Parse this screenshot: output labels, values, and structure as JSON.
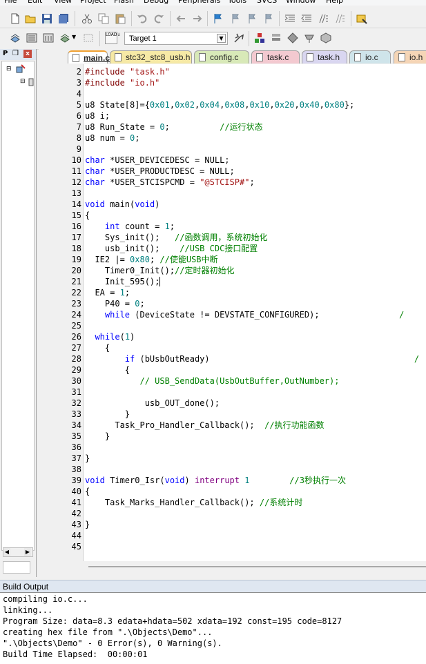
{
  "menu": [
    "File",
    "Edit",
    "View",
    "Project",
    "Flash",
    "Debug",
    "Peripherals",
    "Tools",
    "SVCS",
    "Window",
    "Help"
  ],
  "toolbar": {
    "target_label": "Target 1",
    "load_label": "LOAD"
  },
  "project_panel": {
    "title": "P",
    "pin": "❒",
    "close": "x"
  },
  "tabs": [
    {
      "label": "main.c",
      "active": true,
      "color": "#ffffff"
    },
    {
      "label": "stc32_stc8_usb.h",
      "active": false,
      "color": "#f6e9a5"
    },
    {
      "label": "config.c",
      "active": false,
      "color": "#d8e9b8"
    },
    {
      "label": "task.c",
      "active": false,
      "color": "#f3c9d0"
    },
    {
      "label": "task.h",
      "active": false,
      "color": "#d9d6f0"
    },
    {
      "label": "io.c",
      "active": false,
      "color": "#cfe4ea"
    },
    {
      "label": "io.h",
      "active": false,
      "color": "#f5d5b6"
    }
  ],
  "code": [
    {
      "n": "2",
      "html": "<span class=\"pp\">#include</span> <span class=\"str\">\"task.h\"</span>"
    },
    {
      "n": "3",
      "html": "<span class=\"pp\">#include</span> <span class=\"str\">\"io.h\"</span>"
    },
    {
      "n": "4",
      "html": ""
    },
    {
      "n": "5",
      "html": "u8 State[8]={<span class=\"num\">0x01</span>,<span class=\"num\">0x02</span>,<span class=\"num\">0x04</span>,<span class=\"num\">0x08</span>,<span class=\"num\">0x10</span>,<span class=\"num\">0x20</span>,<span class=\"num\">0x40</span>,<span class=\"num\">0x80</span>};"
    },
    {
      "n": "6",
      "html": "u8 i;"
    },
    {
      "n": "7",
      "html": "u8 Run_State = <span class=\"num\">0</span>;          <span class=\"cmt\">//运行状态</span>"
    },
    {
      "n": "8",
      "html": "u8 num = <span class=\"num\">0</span>;"
    },
    {
      "n": "9",
      "html": ""
    },
    {
      "n": "10",
      "html": "<span class=\"kw\">char</span> *USER_DEVICEDESC = NULL;"
    },
    {
      "n": "11",
      "html": "<span class=\"kw\">char</span> *USER_PRODUCTDESC = NULL;"
    },
    {
      "n": "12",
      "html": "<span class=\"kw\">char</span> *USER_STCISPCMD = <span class=\"str\">\"@STCISP#\"</span>;"
    },
    {
      "n": "13",
      "html": ""
    },
    {
      "n": "14",
      "html": "<span class=\"kw\">void</span> main(<span class=\"kw\">void</span>)"
    },
    {
      "n": "15",
      "html": "{"
    },
    {
      "n": "16",
      "html": "    <span class=\"kw\">int</span> count = <span class=\"num\">1</span>;"
    },
    {
      "n": "17",
      "html": "    Sys_init();   <span class=\"cmt\">//函数调用，系统初始化</span>"
    },
    {
      "n": "18",
      "html": "    usb_init();    <span class=\"cmt\">//USB CDC接口配置</span>"
    },
    {
      "n": "19",
      "html": "  IE2 |= <span class=\"num\">0x80</span>; <span class=\"cmt\">//使能USB中断</span>"
    },
    {
      "n": "20",
      "html": "    Timer0_Init();<span class=\"cmt\">//定时器初始化</span>"
    },
    {
      "n": "21",
      "html": "    Init_595();<span class=\"caret\"></span>"
    },
    {
      "n": "22",
      "html": "  EA = <span class=\"num\">1</span>;"
    },
    {
      "n": "23",
      "html": "    P40 = <span class=\"num\">0</span>;"
    },
    {
      "n": "24",
      "html": "    <span class=\"kw\">while</span> (DeviceState != DEVSTATE_CONFIGURED);                <span class=\"cmt\">/</span>"
    },
    {
      "n": "25",
      "html": ""
    },
    {
      "n": "26",
      "html": "  <span class=\"kw\">while</span>(<span class=\"num\">1</span>)"
    },
    {
      "n": "27",
      "html": "    {"
    },
    {
      "n": "28",
      "html": "        <span class=\"kw\">if</span> (bUsbOutReady)                                         <span class=\"cmt\">/</span>"
    },
    {
      "n": "29",
      "html": "        {"
    },
    {
      "n": "30",
      "html": "           <span class=\"cmt\">// USB_SendData(UsbOutBuffer,OutNumber);</span>"
    },
    {
      "n": "31",
      "html": ""
    },
    {
      "n": "32",
      "html": "            usb_OUT_done();"
    },
    {
      "n": "33",
      "html": "        }"
    },
    {
      "n": "34",
      "html": "      Task_Pro_Handler_Callback();  <span class=\"cmt\">//执行功能函数</span>"
    },
    {
      "n": "35",
      "html": "    }"
    },
    {
      "n": "36",
      "html": ""
    },
    {
      "n": "37",
      "html": "}"
    },
    {
      "n": "38",
      "html": ""
    },
    {
      "n": "39",
      "html": "<span class=\"kw\">void</span> Timer0_Isr(<span class=\"kw\">void</span>) <span class=\"irq\">interrupt</span> <span class=\"num\">1</span>        <span class=\"cmt\">//3秒执行一次</span>"
    },
    {
      "n": "40",
      "html": "{"
    },
    {
      "n": "41",
      "html": "    Task_Marks_Handler_Callback(); <span class=\"cmt\">//系统计时</span>"
    },
    {
      "n": "42",
      "html": ""
    },
    {
      "n": "43",
      "html": "}"
    },
    {
      "n": "44",
      "html": ""
    },
    {
      "n": "45",
      "html": ""
    }
  ],
  "build_output": {
    "title": "Build Output",
    "lines": [
      "compiling io.c...",
      "linking...",
      "Program Size: data=8.3 edata+hdata=502 xdata=192 const=195 code=8127",
      "creating hex file from \".\\Objects\\Demo\"...",
      "\".\\Objects\\Demo\" - 0 Error(s), 0 Warning(s).",
      "Build Time Elapsed:  00:00:01"
    ]
  }
}
